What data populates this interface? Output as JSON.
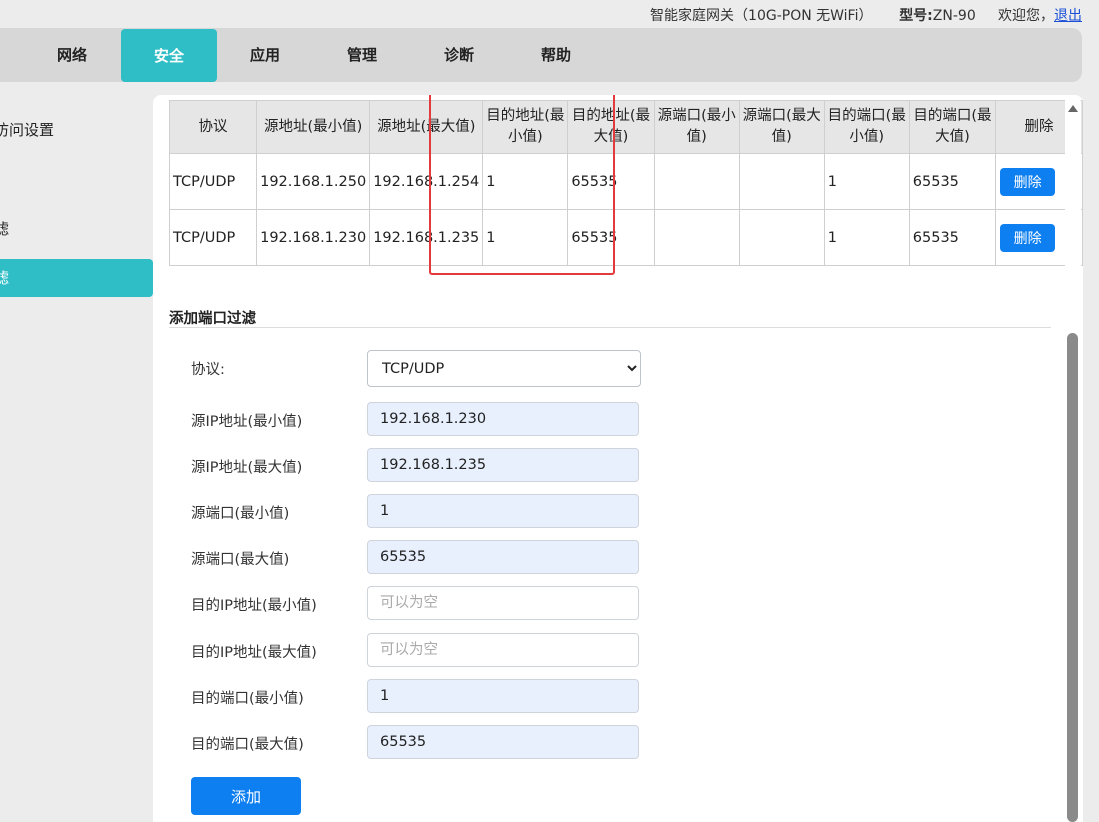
{
  "header": {
    "product": "智能家庭网关（10G-PON 无WiFi）",
    "model_label": "型号:",
    "model_value": "ZN-90",
    "welcome": "欢迎您，",
    "logout": "退出"
  },
  "nav": {
    "items": [
      "网络",
      "安全",
      "应用",
      "管理",
      "诊断",
      "帮助"
    ],
    "active": "安全"
  },
  "sidebar": {
    "items": [
      "访问设置",
      "滤",
      "滤"
    ],
    "active_index": 2
  },
  "table": {
    "headers": [
      "协议",
      "源地址(最小值)",
      "源地址(最大值)",
      "目的地址(最小值)",
      "目的地址(最大值)",
      "源端口(最小值)",
      "源端口(最大值)",
      "目的端口(最小值)",
      "目的端口(最大值)",
      "删除"
    ],
    "rows": [
      {
        "protocol": "TCP/UDP",
        "src_min": "192.168.1.250",
        "src_max": "192.168.1.254",
        "dst_min": "1",
        "dst_max": "65535",
        "sport_min": "",
        "sport_max": "",
        "dport_min": "1",
        "dport_max": "65535"
      },
      {
        "protocol": "TCP/UDP",
        "src_min": "192.168.1.230",
        "src_max": "192.168.1.235",
        "dst_min": "1",
        "dst_max": "65535",
        "sport_min": "",
        "sport_max": "",
        "dport_min": "1",
        "dport_max": "65535"
      }
    ],
    "delete_label": "删除",
    "highlight_color": "#e23b3b"
  },
  "form": {
    "title": "添加端口过滤",
    "protocol_label": "协议:",
    "protocol_value": "TCP/UDP",
    "protocol_options": [
      "TCP/UDP"
    ],
    "fields": [
      {
        "label": "源IP地址(最小值)",
        "value": "192.168.1.230",
        "placeholder": ""
      },
      {
        "label": "源IP地址(最大值)",
        "value": "192.168.1.235",
        "placeholder": ""
      },
      {
        "label": "源端口(最小值)",
        "value": "1",
        "placeholder": ""
      },
      {
        "label": "源端口(最大值)",
        "value": "65535",
        "placeholder": ""
      },
      {
        "label": "目的IP地址(最小值)",
        "value": "",
        "placeholder": "可以为空"
      },
      {
        "label": "目的IP地址(最大值)",
        "value": "",
        "placeholder": "可以为空"
      },
      {
        "label": "目的端口(最小值)",
        "value": "1",
        "placeholder": ""
      },
      {
        "label": "目的端口(最大值)",
        "value": "65535",
        "placeholder": ""
      }
    ],
    "add_label": "添加"
  },
  "colors": {
    "accent": "#2fbdc6",
    "button": "#0d7ff0",
    "link": "#1a4fd6"
  }
}
